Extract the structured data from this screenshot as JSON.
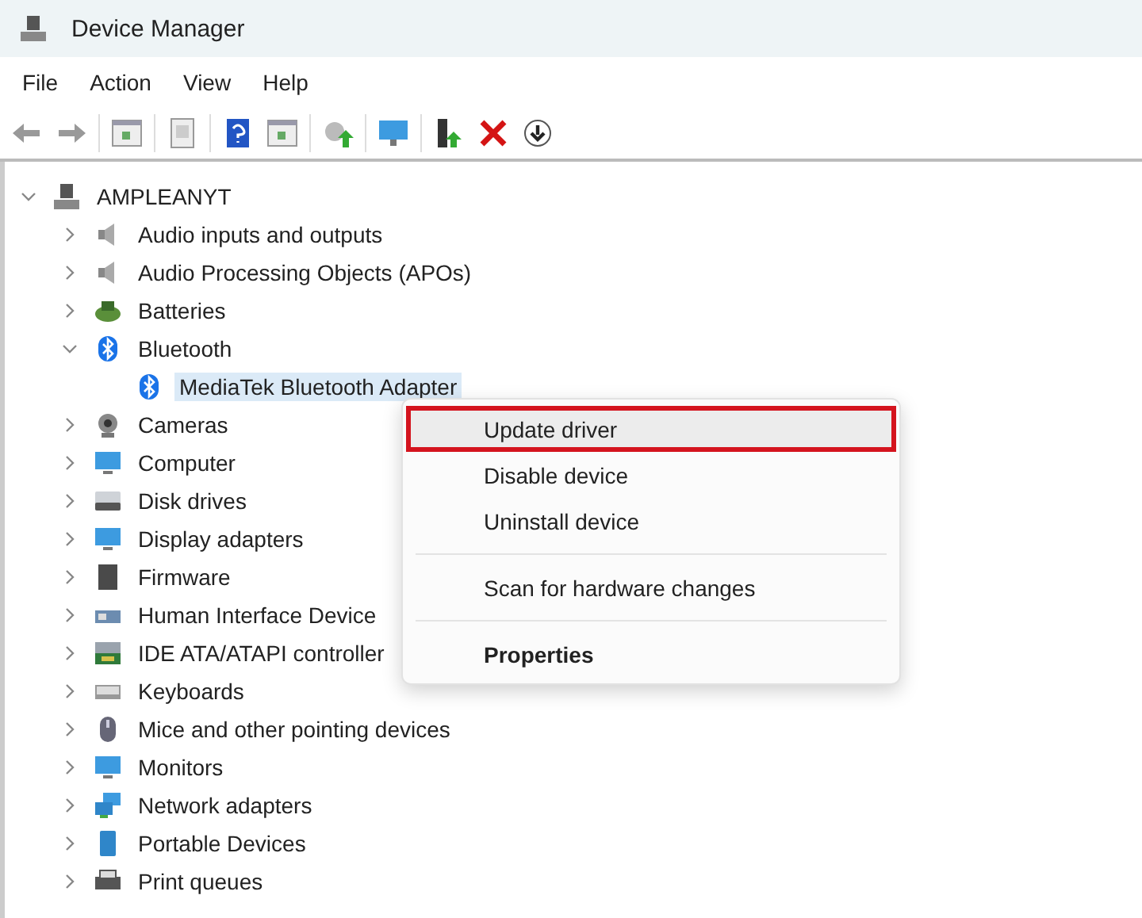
{
  "window": {
    "title": "Device Manager"
  },
  "menu_bar": [
    "File",
    "Action",
    "View",
    "Help"
  ],
  "tree": {
    "label": "AMPLEANYT",
    "kind": "computer",
    "expanded": true,
    "children": [
      {
        "label": "Audio inputs and outputs",
        "kind": "speaker",
        "expanded": false
      },
      {
        "label": "Audio Processing Objects (APOs)",
        "kind": "speaker",
        "expanded": false
      },
      {
        "label": "Batteries",
        "kind": "battery",
        "expanded": false
      },
      {
        "label": "Bluetooth",
        "kind": "bluetooth",
        "expanded": true,
        "children": [
          {
            "label": "MediaTek Bluetooth Adapter",
            "kind": "bluetooth",
            "selected": true
          }
        ]
      },
      {
        "label": "Cameras",
        "kind": "camera",
        "expanded": false
      },
      {
        "label": "Computer",
        "kind": "monitor",
        "expanded": false
      },
      {
        "label": "Disk drives",
        "kind": "disk",
        "expanded": false
      },
      {
        "label": "Display adapters",
        "kind": "monitor",
        "expanded": false
      },
      {
        "label": "Firmware",
        "kind": "chip",
        "expanded": false
      },
      {
        "label": "Human Interface Device",
        "kind": "hid",
        "expanded": false
      },
      {
        "label": "IDE ATA/ATAPI controller",
        "kind": "board",
        "expanded": false
      },
      {
        "label": "Keyboards",
        "kind": "keyboard",
        "expanded": false
      },
      {
        "label": "Mice and other pointing devices",
        "kind": "mouse",
        "expanded": false
      },
      {
        "label": "Monitors",
        "kind": "monitor",
        "expanded": false
      },
      {
        "label": "Network adapters",
        "kind": "network",
        "expanded": false
      },
      {
        "label": "Portable Devices",
        "kind": "portable",
        "expanded": false
      },
      {
        "label": "Print queues",
        "kind": "printer",
        "expanded": false
      }
    ]
  },
  "context_menu": [
    {
      "label": "Update driver",
      "kind": "item",
      "selected": true
    },
    {
      "label": "Disable device",
      "kind": "item",
      "selected": false
    },
    {
      "label": "Uninstall device",
      "kind": "item",
      "selected": false
    },
    {
      "kind": "separator"
    },
    {
      "label": "Scan for hardware changes",
      "kind": "item",
      "selected": false
    },
    {
      "kind": "separator"
    },
    {
      "label": "Properties",
      "kind": "default",
      "selected": false
    }
  ]
}
